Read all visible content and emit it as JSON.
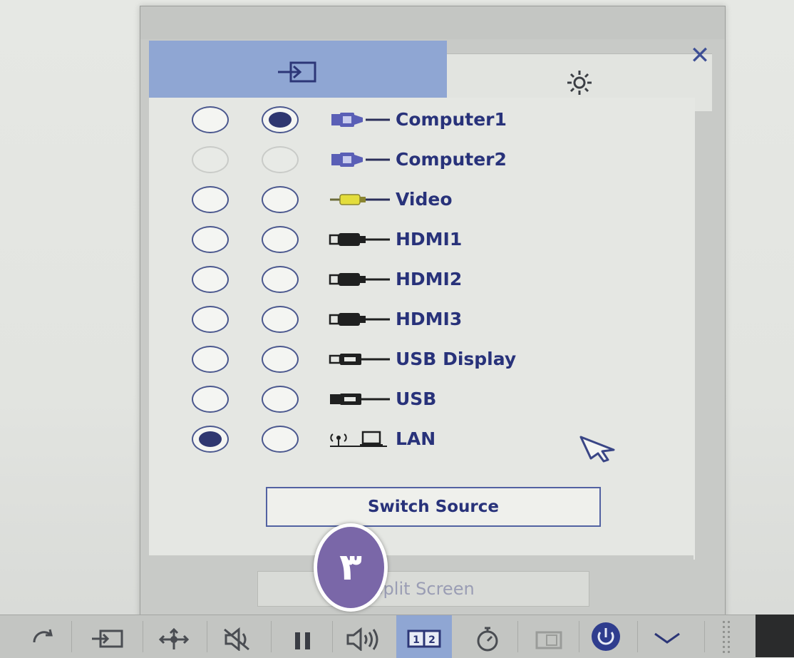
{
  "dialog": {
    "close_glyph": "✕",
    "tabs": [
      {
        "name": "input-source",
        "icon": "input-source-icon",
        "active": true
      },
      {
        "name": "settings",
        "icon": "gear-icon",
        "active": false
      }
    ]
  },
  "sources": [
    {
      "label": "Computer1",
      "icon": "vga-connector-icon",
      "col_a": "empty",
      "col_b": "selected"
    },
    {
      "label": "Computer2",
      "icon": "vga-connector-icon",
      "col_a": "disabled",
      "col_b": "disabled"
    },
    {
      "label": "Video",
      "icon": "rca-connector-icon",
      "col_a": "empty",
      "col_b": "empty"
    },
    {
      "label": "HDMI1",
      "icon": "hdmi-connector-icon",
      "col_a": "empty",
      "col_b": "empty"
    },
    {
      "label": "HDMI2",
      "icon": "hdmi-connector-icon",
      "col_a": "empty",
      "col_b": "empty"
    },
    {
      "label": "HDMI3",
      "icon": "hdmi-connector-icon",
      "col_a": "empty",
      "col_b": "empty"
    },
    {
      "label": "USB Display",
      "icon": "usb-connector-icon",
      "col_a": "empty",
      "col_b": "empty"
    },
    {
      "label": "USB",
      "icon": "usb-connector-icon",
      "col_a": "empty",
      "col_b": "empty"
    },
    {
      "label": "LAN",
      "icon": "lan-network-icon",
      "col_a": "selected",
      "col_b": "empty"
    }
  ],
  "buttons": {
    "switch_source": "Switch Source",
    "split_screen": "Split Screen"
  },
  "step_badge": "٣",
  "toolbar": {
    "items": [
      {
        "name": "refresh-icon"
      },
      {
        "name": "input-icon"
      },
      {
        "name": "move-icon"
      },
      {
        "name": "mute-icon"
      },
      {
        "name": "pause-icon"
      },
      {
        "name": "volume-icon"
      },
      {
        "name": "split-screen-icon",
        "label": "1|2",
        "active": true
      },
      {
        "name": "timer-icon"
      },
      {
        "name": "document-icon"
      },
      {
        "name": "power-icon"
      },
      {
        "name": "chevron-down-icon"
      }
    ]
  },
  "colors": {
    "accent_tab": "#8fa6d3",
    "text_primary": "#28327a",
    "radio_border": "#4a578e",
    "radio_fill": "#2f3770",
    "badge": "#7a67a8"
  }
}
